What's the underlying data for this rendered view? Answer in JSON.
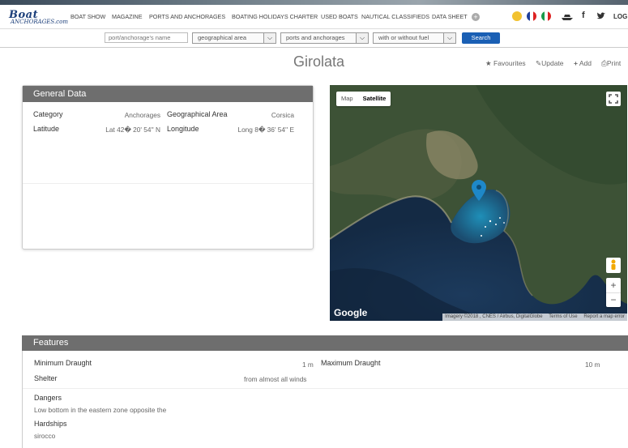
{
  "logo": {
    "line1": "Boat",
    "line2": "ANCHORAGES.com"
  },
  "nav": {
    "items": [
      "BOAT SHOW",
      "MAGAZINE",
      "PORTS AND ANCHORAGES",
      "BOATING HOLIDAYS CHARTER",
      "USED BOATS",
      "NAUTICAL CLASSIFIEDS",
      "DATA SHEET"
    ],
    "login": "LOG I"
  },
  "search": {
    "name_placeholder": "port/anchorage's name",
    "area": "geographical area",
    "type": "ports and anchorages",
    "fuel": "with or without fuel",
    "button": "Search"
  },
  "page": {
    "title": "Girolata",
    "actions": {
      "favourites": "Favourites",
      "update": "Update",
      "add": "Add",
      "print": "Print"
    }
  },
  "general": {
    "header": "General Data",
    "category_label": "Category",
    "category": "Anchorages",
    "area_label": "Geographical Area",
    "area": "Corsica",
    "lat_label": "Latitude",
    "lat": "Lat 42� 20' 54'' N",
    "lon_label": "Longitude",
    "lon": "Long 8� 36' 54'' E"
  },
  "map": {
    "tab_map": "Map",
    "tab_satellite": "Satellite",
    "brand": "Google",
    "attribution": "Imagery ©2018 , CNES / Airbus, DigitalGlobe",
    "terms": "Terms of Use",
    "report": "Report a map error",
    "zoom_in": "+",
    "zoom_out": "−"
  },
  "features": {
    "header": "Features",
    "min_label": "Minimum Draught",
    "min": "1 m",
    "max_label": "Maximum Draught",
    "max": "10 m",
    "shelter_label": "Shelter",
    "shelter": "from almost all winds",
    "dangers_label": "Dangers",
    "dangers": "Low bottom in the eastern zone opposite the",
    "hardships_label": "Hardships",
    "hardships": "sirocco"
  },
  "colors": {
    "header": "#6e6e6e",
    "search_button": "#1a5fb4",
    "pin": "#1e88c8",
    "logo": "#1c3f7a"
  }
}
